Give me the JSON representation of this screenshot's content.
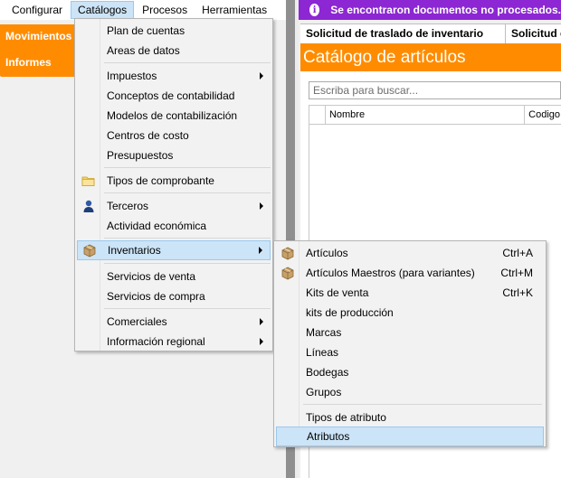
{
  "menubar": {
    "items": [
      "Configurar",
      "Catálogos",
      "Procesos",
      "Herramientas"
    ]
  },
  "leftnav": {
    "items": [
      "Movimientos",
      "Informes"
    ]
  },
  "notification": {
    "text": "Se encontraron documentos no procesados.",
    "icon": "info-icon",
    "color": "#8c27d3"
  },
  "doc_tabs": [
    "Solicitud de traslado de inventario",
    "Solicitud d"
  ],
  "panel": {
    "title": "Catálogo de artículos",
    "search_placeholder": "Escriba para buscar...",
    "columns": [
      "Nombre",
      "Codigo"
    ],
    "accent": "#ff8c00"
  },
  "catalogos_menu": {
    "items": [
      {
        "label": "Plan de cuentas"
      },
      {
        "label": "Areas de datos"
      },
      {
        "label": "Impuestos",
        "submenu": true
      },
      {
        "label": "Conceptos de contabilidad"
      },
      {
        "label": "Modelos de contabilización"
      },
      {
        "label": "Centros de costo"
      },
      {
        "label": "Presupuestos"
      },
      {
        "label": "Tipos de comprobante",
        "icon": "folder-icon"
      },
      {
        "label": "Terceros",
        "icon": "person-icon",
        "submenu": true
      },
      {
        "label": "Actividad económica"
      },
      {
        "label": "Inventarios",
        "icon": "box-icon",
        "submenu": true,
        "highlighted": true
      },
      {
        "label": "Servicios de venta"
      },
      {
        "label": "Servicios de compra"
      },
      {
        "label": "Comerciales",
        "submenu": true
      },
      {
        "label": "Información regional",
        "submenu": true
      }
    ]
  },
  "inventarios_menu": {
    "items": [
      {
        "label": "Artículos",
        "shortcut": "Ctrl+A",
        "icon": "box-icon"
      },
      {
        "label": "Artículos Maestros (para variantes)",
        "shortcut": "Ctrl+M",
        "icon": "box-icon"
      },
      {
        "label": "Kits de venta",
        "shortcut": "Ctrl+K"
      },
      {
        "label": "kits de producción"
      },
      {
        "label": "Marcas"
      },
      {
        "label": "Líneas"
      },
      {
        "label": "Bodegas"
      },
      {
        "label": "Grupos"
      },
      {
        "label": "Tipos de atributo"
      },
      {
        "label": "Atributos",
        "highlighted": true
      }
    ]
  }
}
